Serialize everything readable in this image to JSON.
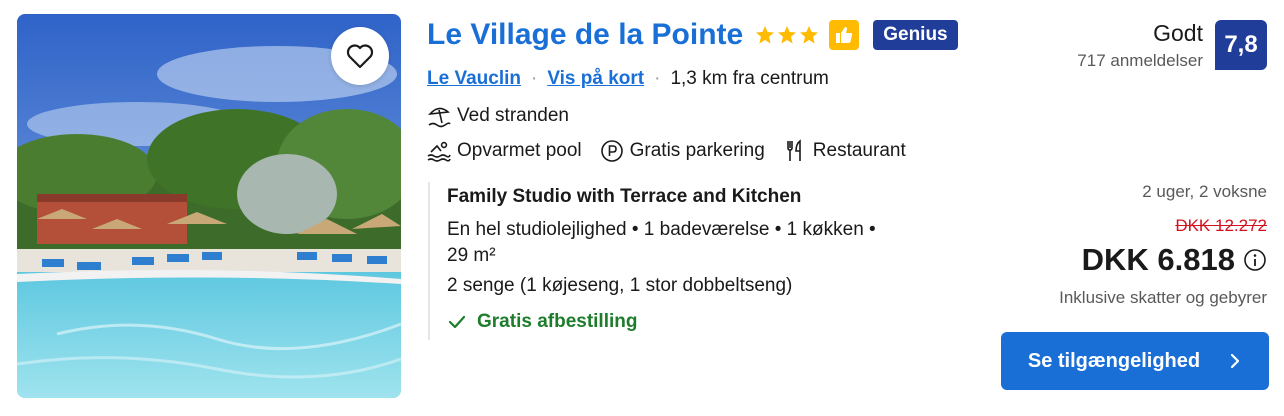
{
  "hotel": {
    "name": "Le Village de la Pointe",
    "stars": 3,
    "genius_label": "Genius",
    "location_link": "Le Vauclin",
    "map_link": "Vis på kort",
    "distance": "1,3 km fra centrum"
  },
  "amenities": {
    "beach": "Ved stranden",
    "pool": "Opvarmet pool",
    "parking": "Gratis parkering",
    "restaurant": "Restaurant"
  },
  "room": {
    "title": "Family Studio with Terrace and Kitchen",
    "details_line1": "En hel studiolejlighed • 1 badeværelse • 1 køkken •",
    "details_line2": "29 m²",
    "beds": "2 senge (1 køjeseng, 1 stor dobbeltseng)",
    "free_cancel": "Gratis afbestilling"
  },
  "rating": {
    "word": "Godt",
    "reviews": "717 anmeldelser",
    "score": "7,8"
  },
  "pricing": {
    "guests": "2 uger, 2 voksne",
    "old_price": "DKK 12.272",
    "price": "DKK 6.818",
    "taxes": "Inklusive skatter og gebyrer"
  },
  "cta": {
    "label": "Se tilgængelighed"
  },
  "colors": {
    "link": "#1a6fd6",
    "genius": "#1f3d99",
    "star": "#febb02",
    "cancel": "#1d7d2b",
    "old_price": "#d4111e"
  },
  "icons": [
    "heart-icon",
    "star-icon",
    "thumbs-up-icon",
    "beach-umbrella-icon",
    "pool-icon",
    "parking-icon",
    "restaurant-icon",
    "checkmark-icon",
    "info-icon",
    "chevron-right-icon"
  ]
}
